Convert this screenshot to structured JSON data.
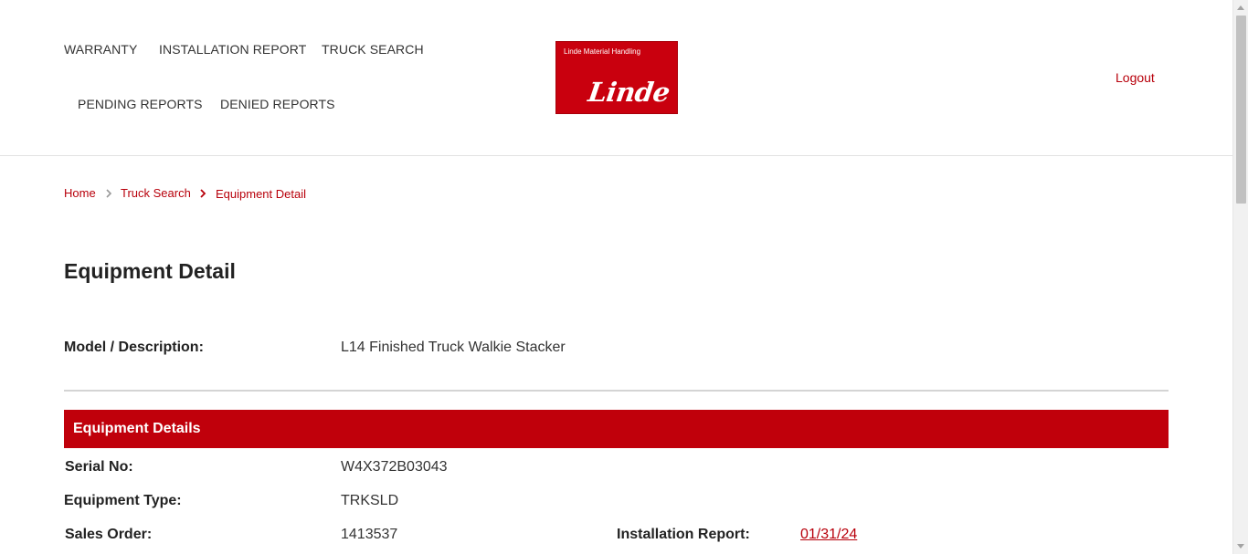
{
  "nav": {
    "warranty": "WARRANTY",
    "installation_report": "INSTALLATION REPORT",
    "truck_search": "TRUCK SEARCH",
    "pending_reports": "PENDING REPORTS",
    "denied_reports": "DENIED REPORTS"
  },
  "logo": {
    "tagline": "Linde Material Handling",
    "wordmark": "Linde"
  },
  "header": {
    "logout": "Logout"
  },
  "breadcrumb": [
    "Home",
    "Truck Search",
    "Equipment Detail"
  ],
  "page_title": "Equipment Detail",
  "model": {
    "label": "Model / Description:",
    "value": "L14 Finished Truck Walkie Stacker"
  },
  "section": {
    "title": "Equipment Details",
    "serial": {
      "label": "Serial No:",
      "value": "W4X372B03043"
    },
    "equipment_type": {
      "label": "Equipment Type:",
      "value": "TRKSLD"
    },
    "sales_order": {
      "label": "Sales Order:",
      "value": "1413537"
    },
    "installation_report": {
      "label": "Installation Report:",
      "value": "01/31/24"
    }
  },
  "colors": {
    "brand_red": "#c0000b",
    "link_red": "#b8000b"
  }
}
